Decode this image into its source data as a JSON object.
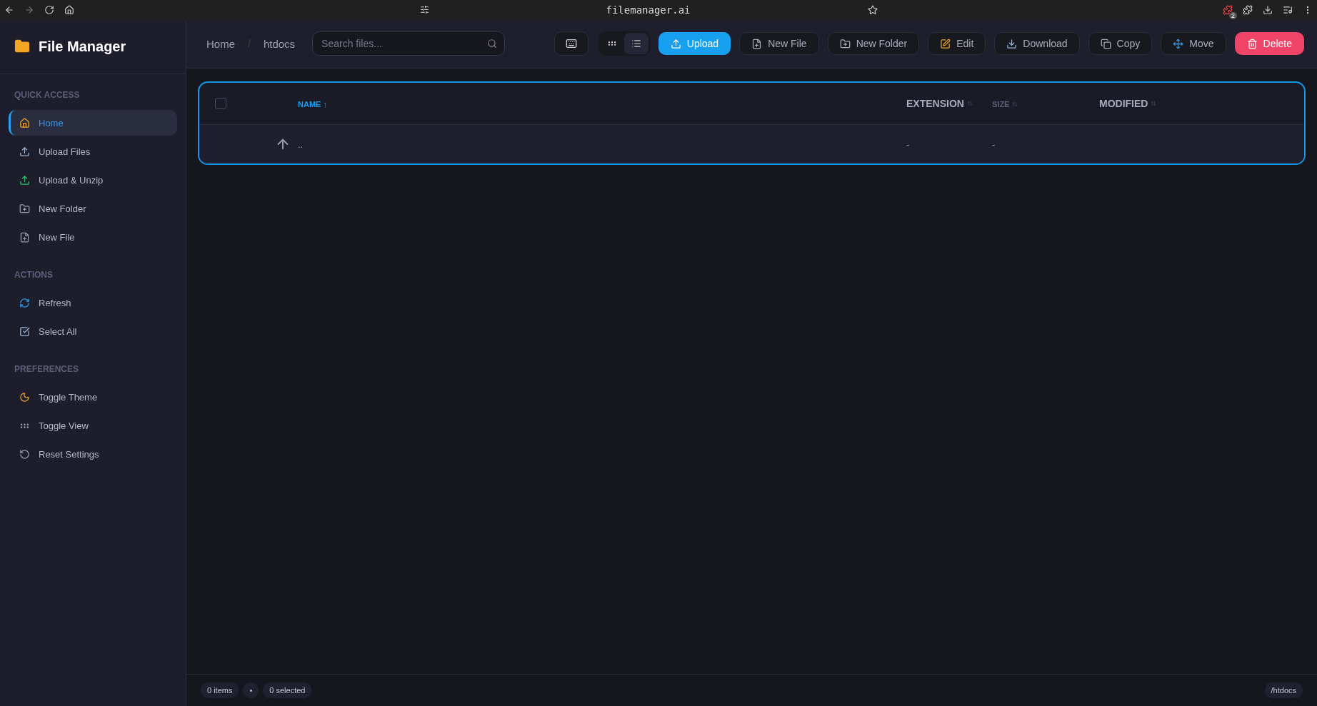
{
  "browser": {
    "url": "filemanager.ai",
    "extension_badge": "2"
  },
  "sidebar": {
    "title": "File Manager",
    "sections": [
      {
        "heading": "QUICK ACCESS",
        "items": [
          {
            "label": "Home",
            "selected": true
          },
          {
            "label": "Upload Files",
            "selected": false
          },
          {
            "label": "Upload & Unzip",
            "selected": false
          },
          {
            "label": "New Folder",
            "selected": false
          },
          {
            "label": "New File",
            "selected": false
          }
        ]
      },
      {
        "heading": "ACTIONS",
        "items": [
          {
            "label": "Refresh",
            "selected": false
          },
          {
            "label": "Select All",
            "selected": false
          }
        ]
      },
      {
        "heading": "PREFERENCES",
        "items": [
          {
            "label": "Toggle Theme",
            "selected": false
          },
          {
            "label": "Toggle View",
            "selected": false
          },
          {
            "label": "Reset Settings",
            "selected": false
          }
        ]
      }
    ]
  },
  "breadcrumb": {
    "items": [
      "Home",
      "htdocs"
    ],
    "separator": "/"
  },
  "search": {
    "placeholder": "Search files..."
  },
  "view_toggle": [
    {
      "kind": "grid",
      "selected": false
    },
    {
      "kind": "list",
      "selected": true
    }
  ],
  "actions": [
    {
      "label": "Upload",
      "kind": "primary"
    },
    {
      "label": "New File",
      "kind": "plain"
    },
    {
      "label": "New Folder",
      "kind": "plain"
    },
    {
      "label": "Edit",
      "kind": "plain"
    },
    {
      "label": "Download",
      "kind": "plain"
    },
    {
      "label": "Copy",
      "kind": "plain"
    },
    {
      "label": "Move",
      "kind": "plain"
    },
    {
      "label": "Delete",
      "kind": "danger"
    }
  ],
  "table": {
    "select_all": {
      "checked": false
    },
    "columns": [
      {
        "label": "NAME",
        "sorted": true,
        "sort_mark": "↑"
      },
      {
        "label": "EXTENSION",
        "sorted": false
      },
      {
        "label": "SIZE",
        "sorted": false
      },
      {
        "label": "MODIFIED",
        "sorted": false
      }
    ],
    "rows": [
      {
        "name": "..",
        "extension": "-",
        "size": "-"
      }
    ]
  },
  "status_bar": {
    "items": "0 items",
    "separator": "•",
    "selected": "0 selected",
    "path": "/htdocs"
  }
}
